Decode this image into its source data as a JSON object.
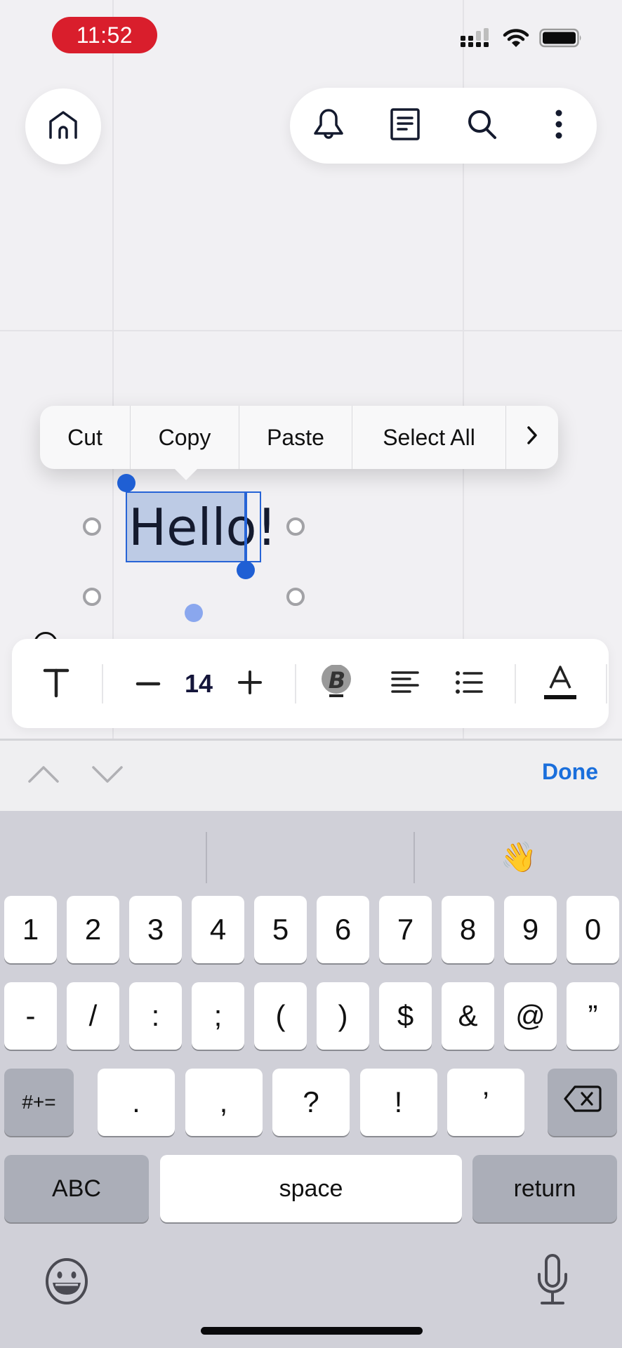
{
  "status_bar": {
    "time": "11:52",
    "time_pill_color": "#d91e2c",
    "icons": [
      "cellular-signal-icon",
      "wifi-icon",
      "battery-icon"
    ]
  },
  "top_bar": {
    "home_icon": "home-icon",
    "actions": [
      {
        "name": "notifications",
        "icon": "bell-icon"
      },
      {
        "name": "document",
        "icon": "document-icon"
      },
      {
        "name": "search",
        "icon": "search-icon"
      },
      {
        "name": "more",
        "icon": "more-vertical-icon"
      }
    ]
  },
  "context_menu": {
    "items": [
      "Cut",
      "Copy",
      "Paste",
      "Select All"
    ],
    "more_icon": "chevron-right-icon"
  },
  "text_element": {
    "selected_text": "Hello",
    "unselected_text": "!",
    "full_text": "Hello!",
    "selection_color": "#2764d6"
  },
  "text_toolbar": {
    "text_style_icon": "text-style-icon",
    "decrease_icon": "minus-icon",
    "font_size": "14",
    "increase_icon": "plus-icon",
    "bold_icon": "bold-icon",
    "align_icon": "align-left-icon",
    "list_icon": "bullet-list-icon",
    "color_icon": "text-color-icon",
    "color_value": "#111111"
  },
  "accessory_bar": {
    "prev_icon": "chevron-up-icon",
    "next_icon": "chevron-down-icon",
    "done_label": "Done",
    "done_color": "#1a6fdc"
  },
  "keyboard": {
    "suggestions": [
      "",
      "",
      "👋"
    ],
    "row1": [
      "1",
      "2",
      "3",
      "4",
      "5",
      "6",
      "7",
      "8",
      "9",
      "0"
    ],
    "row2": [
      "-",
      "/",
      ":",
      ";",
      "(",
      ")",
      "$",
      "&",
      "@",
      "”"
    ],
    "row3": {
      "shift_label": "#+=",
      "keys": [
        ".",
        ",",
        "?",
        "!",
        "’"
      ],
      "delete_icon": "backspace-icon"
    },
    "row4": {
      "abc_label": "ABC",
      "space_label": "space",
      "return_label": "return"
    },
    "emoji_icon": "emoji-icon",
    "mic_icon": "microphone-icon"
  }
}
